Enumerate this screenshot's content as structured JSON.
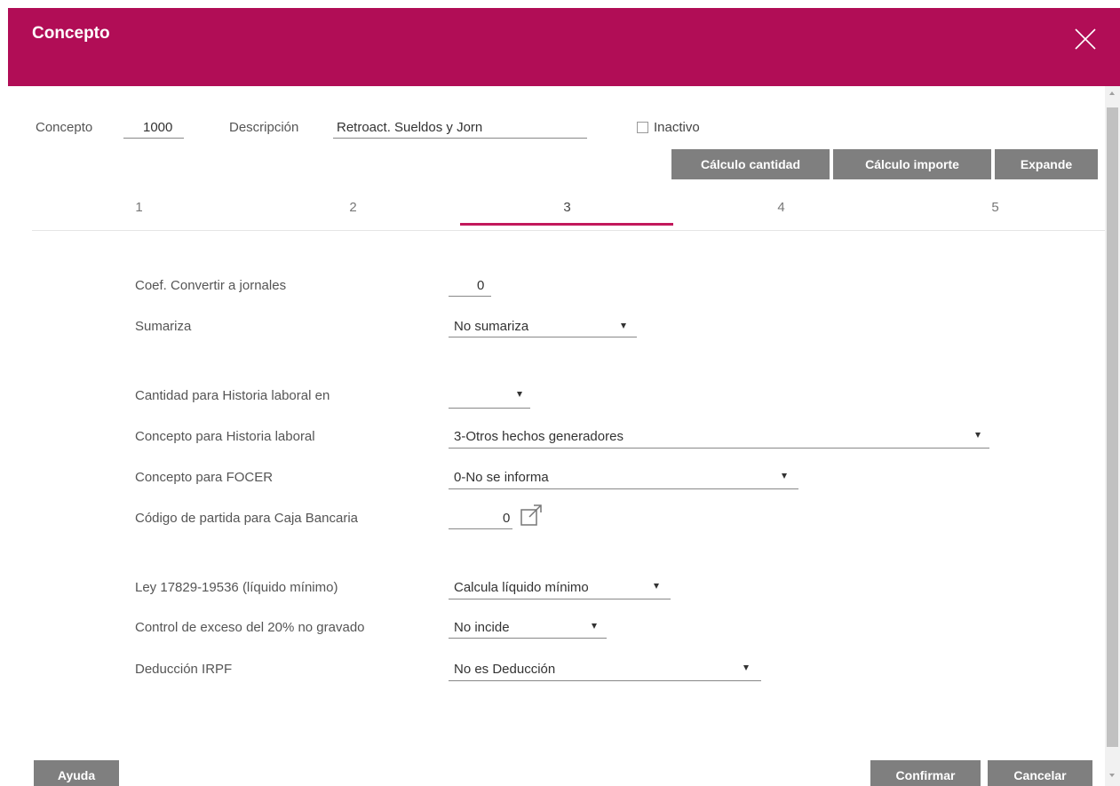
{
  "dialog": {
    "title": "Concepto",
    "close_icon": "close-icon",
    "accent_color": "#b10d56"
  },
  "top": {
    "concepto_label": "Concepto",
    "concepto_value": "1000",
    "descripcion_label": "Descripción",
    "descripcion_value": "Retroact. Sueldos y Jorn",
    "inactivo_label": "Inactivo",
    "inactivo_checked": false
  },
  "buttons": {
    "calculo_cantidad": "Cálculo cantidad",
    "calculo_importe": "Cálculo importe",
    "expande": "Expande",
    "ayuda": "Ayuda",
    "confirmar": "Confirmar",
    "cancelar": "Cancelar"
  },
  "tabs": [
    {
      "label": "1"
    },
    {
      "label": "2"
    },
    {
      "label": "3"
    },
    {
      "label": "4"
    },
    {
      "label": "5"
    }
  ],
  "active_tab": "3",
  "form": {
    "coef_label": "Coef. Convertir a jornales",
    "coef_value": "0",
    "sumariza_label": "Sumariza",
    "sumariza_value": "No sumariza",
    "cantidad_historia_label": "Cantidad para Historia laboral en",
    "cantidad_historia_value": "",
    "concepto_historia_label": "Concepto para Historia laboral",
    "concepto_historia_value": "3-Otros hechos generadores",
    "focer_label": "Concepto para FOCER",
    "focer_value": "0-No se informa",
    "caja_label": "Código de partida para Caja Bancaria",
    "caja_value": "0",
    "ley_label": "Ley 17829-19536 (líquido mínimo)",
    "ley_value": "Calcula líquido mínimo",
    "control_label": "Control de exceso del 20% no gravado",
    "control_value": "No incide",
    "irpf_label": "Deducción IRPF",
    "irpf_value": "No es Deducción"
  }
}
